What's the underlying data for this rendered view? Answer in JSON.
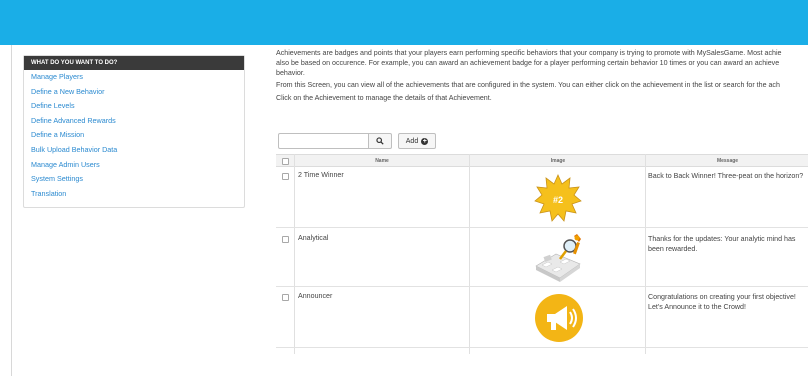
{
  "sidebar": {
    "header": "WHAT DO YOU WANT TO DO?",
    "items": [
      {
        "label": "Manage Players"
      },
      {
        "label": "Define a New Behavior"
      },
      {
        "label": "Define Levels"
      },
      {
        "label": "Define Advanced Rewards"
      },
      {
        "label": "Define a Mission"
      },
      {
        "label": "Bulk Upload Behavior Data"
      },
      {
        "label": "Manage Admin Users"
      },
      {
        "label": "System Settings"
      },
      {
        "label": "Translation"
      }
    ]
  },
  "main": {
    "intro_line1": "Achievements are badges and points that your players earn performing specific behaviors that your company is trying to promote with MySalesGame. Most achie",
    "intro_line2": "also be based on occurence. For example, you can award an achievement badge for a player performing certain behavior 10 times or you can award an achieve",
    "intro_line3": "behavior.",
    "para2": "From this Screen, you can view all of the achievements that are configured in the system. You can either click on the achievement in the list or search for the ach",
    "para3": "Click on the Achievement to manage the details of that Achievement.",
    "search": {
      "value": "",
      "placeholder": ""
    },
    "add_label": "Add",
    "table": {
      "columns": [
        "Name",
        "Image",
        "Message"
      ],
      "rows": [
        {
          "name": "2 Time Winner",
          "image": "2-badge-star",
          "message": "Back to Back Winner! Three-peat on the horizon?"
        },
        {
          "name": "Analytical",
          "image": "puzzle-magnifier",
          "message": "Thanks for the updates: Your analytic mind has been rewarded."
        },
        {
          "name": "Announcer",
          "image": "megaphone-circle",
          "message": "Congratulations on creating your first objective! Let's Announce it to the Crowd!"
        }
      ],
      "badge_text": "#2"
    }
  },
  "colors": {
    "topbar": "#1aaee7",
    "link": "#2b8ad0",
    "badge_star": "#f5c01c",
    "megaphone_circle": "#f3b515"
  }
}
